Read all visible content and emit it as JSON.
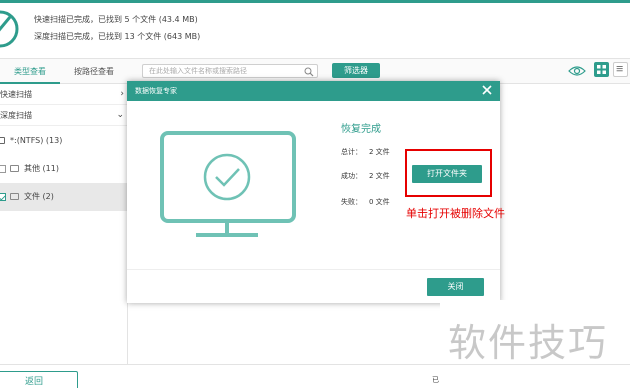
{
  "header": {
    "quick_scan_status": "快速扫描已完成，已找到 5 个文件 (43.4 MB)",
    "deep_scan_status": "深度扫描已完成，已找到 13 个文件 (643 MB)"
  },
  "toolbar": {
    "tab_by_type": "类型查看",
    "tab_by_path": "按路径查看",
    "search_placeholder": "在此处输入文件名称或搜索路径",
    "filter_label": "筛选器"
  },
  "sidebar": {
    "quick_scan": "快速扫描",
    "deep_scan": "深度扫描",
    "tree": [
      {
        "label": "*:(NTFS) (13)"
      },
      {
        "label": "其他 (11)"
      },
      {
        "label": "文件 (2)"
      }
    ]
  },
  "dialog": {
    "title": "数据恢复专家",
    "heading": "恢复完成",
    "total_label": "总计：",
    "total_value": "2 文件",
    "success_label": "成功：",
    "success_value": "2 文件",
    "fail_label": "失败：",
    "fail_value": "0 文件",
    "open_folder_label": "打开文件夹",
    "close_label": "关闭"
  },
  "annotation": {
    "text": "单击打开被删除文件",
    "color": "#e60000"
  },
  "bottom": {
    "back_label": "返回",
    "corner_char": "已"
  },
  "watermark": {
    "text": "软件技巧"
  },
  "colors": {
    "accent": "#2e9c8c"
  },
  "icons": {
    "header_logo": "disabled-circle-icon",
    "search": "search-icon",
    "view": "eye-icon",
    "grid_view": "grid-icon",
    "list_view": "list-icon",
    "dialog_close": "close-icon",
    "monitor": "monitor-check-icon"
  }
}
